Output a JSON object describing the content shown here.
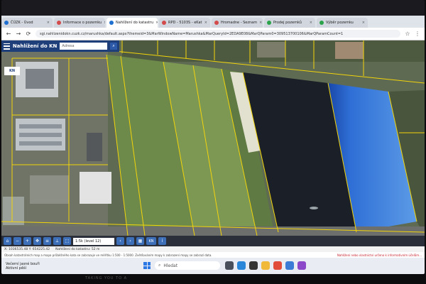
{
  "browser": {
    "tabs": [
      {
        "label": "ČÚZK - Úvod",
        "color": "#1f6fd0",
        "active": false
      },
      {
        "label": "Informace o pozemku",
        "color": "#d24a4a",
        "active": false
      },
      {
        "label": "Nahlížení do katastru",
        "color": "#1f6fd0",
        "active": true
      },
      {
        "label": "RPD - 5103S - eKat",
        "color": "#d24a4a",
        "active": false
      },
      {
        "label": "Hromadne - Seznam",
        "color": "#d24a4a",
        "active": false
      },
      {
        "label": "Prodej pozemků",
        "color": "#2aa34a",
        "active": false
      },
      {
        "label": "Výběr pozemku",
        "color": "#2aa34a",
        "active": false
      }
    ],
    "url": "sgi.nahlizenidokn.cuzk.cz/marushka/default.aspx?themeid=3&MarWindowName=Marushka&MarQueryId=2EDA9E08&MarQParam0=309513700106&MarQParamCount=1"
  },
  "app": {
    "title": "Nahlížení do KN",
    "search_placeholder": "Adresa",
    "logo": "KN"
  },
  "toolbar": {
    "scale_select": "1:5k (level 12)",
    "kn_label": "KN"
  },
  "status": {
    "coords": "X: 1036535.48  Y: 654225.42",
    "mode": "Nahlížení do katastru: 52 m",
    "notice_left": "Obsah katastrálních map a mapa průběžného kata se zobrazuje ve měřítku 1:500 - 1:5000. Zvětšováním mapy k zobrazení mapy se zobrazí data.",
    "notice_right": "Nahlížení nebo vlastnictví určeno k informativním účelům..."
  },
  "taskbar": {
    "weather_line1": "Večerní jasné bouři",
    "weather_line2": "Aktivní pěší",
    "search_placeholder": "Hledat"
  },
  "below_text": "TAKING YOU TO A"
}
